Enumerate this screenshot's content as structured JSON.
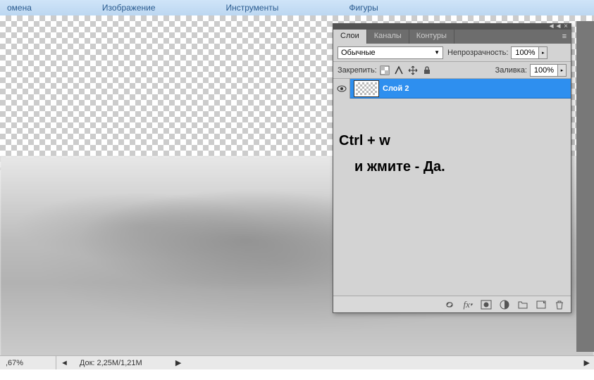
{
  "menubar": {
    "items": [
      "омена",
      "Изображение",
      "Инструменты",
      "Фигуры"
    ]
  },
  "statusbar": {
    "zoom": ",67%",
    "doc": "Док: 2,25M/1,21M"
  },
  "panel": {
    "tabs": [
      "Слои",
      "Каналы",
      "Контуры"
    ],
    "blend_mode": "Обычные",
    "opacity_label": "Непрозрачность:",
    "opacity_value": "100%",
    "lock_label": "Закрепить:",
    "fill_label": "Заливка:",
    "fill_value": "100%",
    "layer_name": "Слой 2"
  },
  "overlay": {
    "line1": "Ctrl  + w",
    "line2": "и жмите  - Да."
  }
}
